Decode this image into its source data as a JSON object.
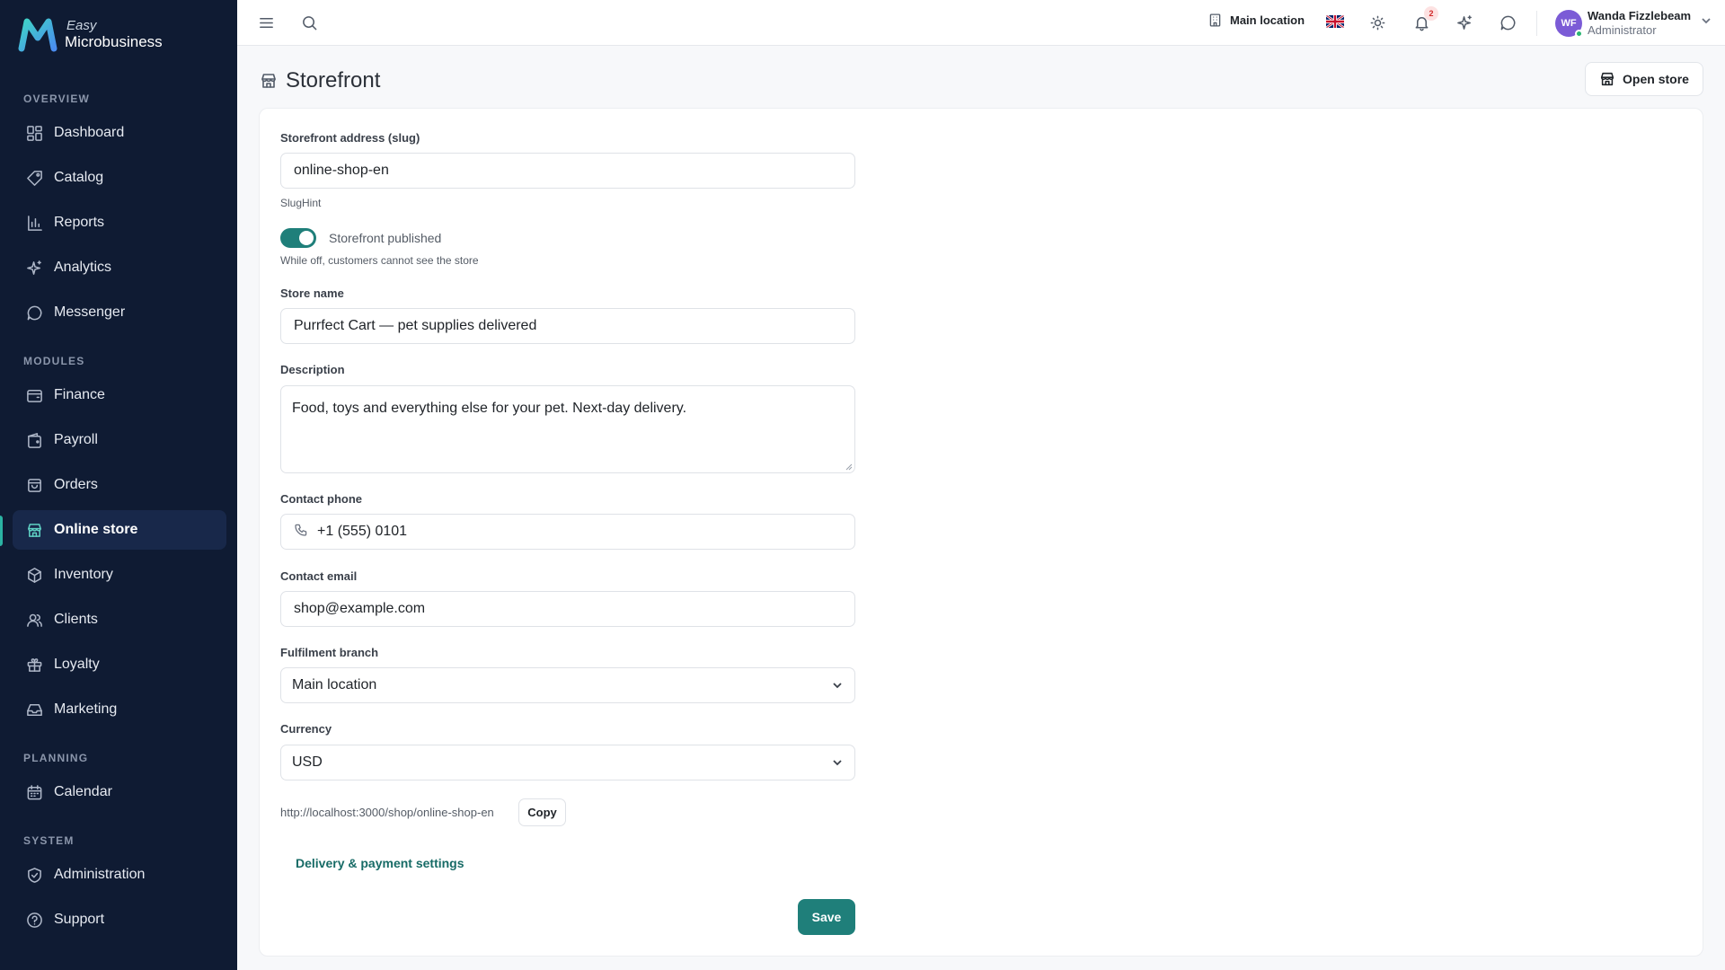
{
  "brand": {
    "easy": "Easy",
    "name": "Microbusiness"
  },
  "sidebar": {
    "sections": [
      {
        "label": "OVERVIEW"
      },
      {
        "label": "MODULES"
      },
      {
        "label": "PLANNING"
      },
      {
        "label": "SYSTEM"
      }
    ],
    "items": [
      {
        "label": "Dashboard",
        "icon": "dashboard-icon"
      },
      {
        "label": "Catalog",
        "icon": "tag-icon"
      },
      {
        "label": "Reports",
        "icon": "bar-chart-icon"
      },
      {
        "label": "Analytics",
        "icon": "sparkles-icon"
      },
      {
        "label": "Messenger",
        "icon": "chat-icon"
      },
      {
        "label": "Finance",
        "icon": "wallet-icon"
      },
      {
        "label": "Payroll",
        "icon": "wallet-icon"
      },
      {
        "label": "Orders",
        "icon": "bag-icon"
      },
      {
        "label": "Online store",
        "icon": "store-icon",
        "active": true
      },
      {
        "label": "Inventory",
        "icon": "box-icon"
      },
      {
        "label": "Clients",
        "icon": "users-icon"
      },
      {
        "label": "Loyalty",
        "icon": "gift-icon"
      },
      {
        "label": "Marketing",
        "icon": "inbox-icon"
      },
      {
        "label": "Calendar",
        "icon": "calendar-icon"
      },
      {
        "label": "Administration",
        "icon": "shield-icon"
      },
      {
        "label": "Support",
        "icon": "help-icon"
      }
    ]
  },
  "topbar": {
    "location": "Main location",
    "notifications_count": "2",
    "user": {
      "initials": "WF",
      "name": "Wanda Fizzlebeam",
      "role": "Administrator"
    }
  },
  "page": {
    "title": "Storefront",
    "open_store": "Open store"
  },
  "form": {
    "slug_label": "Storefront address (slug)",
    "slug_value": "online-shop-en",
    "slug_hint": "SlugHint",
    "published_label": "Storefront published",
    "published": true,
    "published_hint": "While off, customers cannot see the store",
    "store_name_label": "Store name",
    "store_name_value": "Purrfect Cart — pet supplies delivered",
    "description_label": "Description",
    "description_value": "Food, toys and everything else for your pet. Next-day delivery.",
    "phone_label": "Contact phone",
    "phone_value": "+1 (555) 0101",
    "email_label": "Contact email",
    "email_value": "shop@example.com",
    "branch_label": "Fulfilment branch",
    "branch_value": "Main location",
    "currency_label": "Currency",
    "currency_value": "USD",
    "store_url": "http://localhost:3000/shop/online-shop-en",
    "copy_label": "Copy",
    "delivery_link": "Delivery & payment settings",
    "save_label": "Save"
  },
  "colors": {
    "sidebar_bg": "#0f1b33",
    "accent": "#1f7f7a",
    "avatar": "#7b5bd6"
  }
}
